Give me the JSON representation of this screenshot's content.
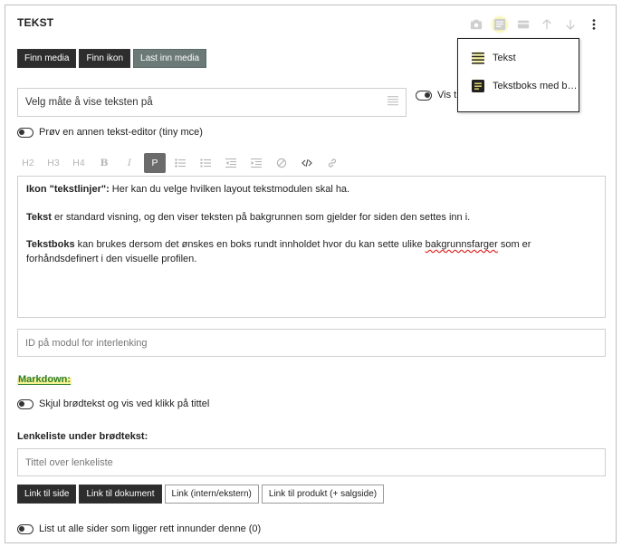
{
  "module": {
    "title": "TEKST"
  },
  "top_icons": {
    "icons": [
      "camera-icon",
      "text-layout-icon",
      "card-icon",
      "arrow-up-icon",
      "arrow-down-icon",
      "more-vert-icon"
    ]
  },
  "media_buttons": {
    "find_media": "Finn media",
    "find_icon": "Finn ikon",
    "upload_media": "Last inn media"
  },
  "display_select": {
    "placeholder": "Velg måte å vise teksten på"
  },
  "vis_toggle": {
    "label": "Vis ti"
  },
  "layout_menu": {
    "items": [
      {
        "label": "Tekst",
        "icon": "lines-icon"
      },
      {
        "label": "Tekstboks med b…",
        "icon": "textbox-icon"
      }
    ],
    "highlight_color": "#f5f078"
  },
  "editor_toggle": {
    "label": "Prøv en annen tekst-editor (tiny mce)"
  },
  "format_toolbar": {
    "h2": "H2",
    "h3": "H3",
    "h4": "H4",
    "bold": "B",
    "italic": "I",
    "paragraph": "P"
  },
  "editor": {
    "p1_bold": "Ikon \"tekstlinjer\":",
    "p1_text": " Her kan du velge hvilken layout tekstmodulen skal ha.",
    "p2_bold": "Tekst",
    "p2_text": " er standard visning, og den viser teksten på bakgrunnen som gjelder for siden den settes inn i.",
    "p3_bold": "Tekstboks",
    "p3_text_a": " kan brukes dersom det ønskes en boks rundt innholdet hvor du kan sette ulike ",
    "p3_spell": "bakgrunnsfarger",
    "p3_text_b": " som er forhåndsdefinert i den visuelle profilen."
  },
  "anchor_input": {
    "placeholder": "ID på modul for interlenking"
  },
  "markdown": {
    "label": "Markdown:"
  },
  "collapse_toggle": {
    "label": "Skjul brødtekst og vis ved klikk på tittel"
  },
  "linklist": {
    "label": "Lenkeliste under brødtekst:",
    "title_placeholder": "Tittel over lenkeliste",
    "buttons": {
      "link_page": "Link til side",
      "link_document": "Link til dokument",
      "link_internal_external": "Link (intern/ekstern)",
      "link_product": "Link til produkt (+ salgside)"
    }
  },
  "subpages_toggle": {
    "label": "List ut alle sider som ligger rett innunder denne (0)"
  }
}
